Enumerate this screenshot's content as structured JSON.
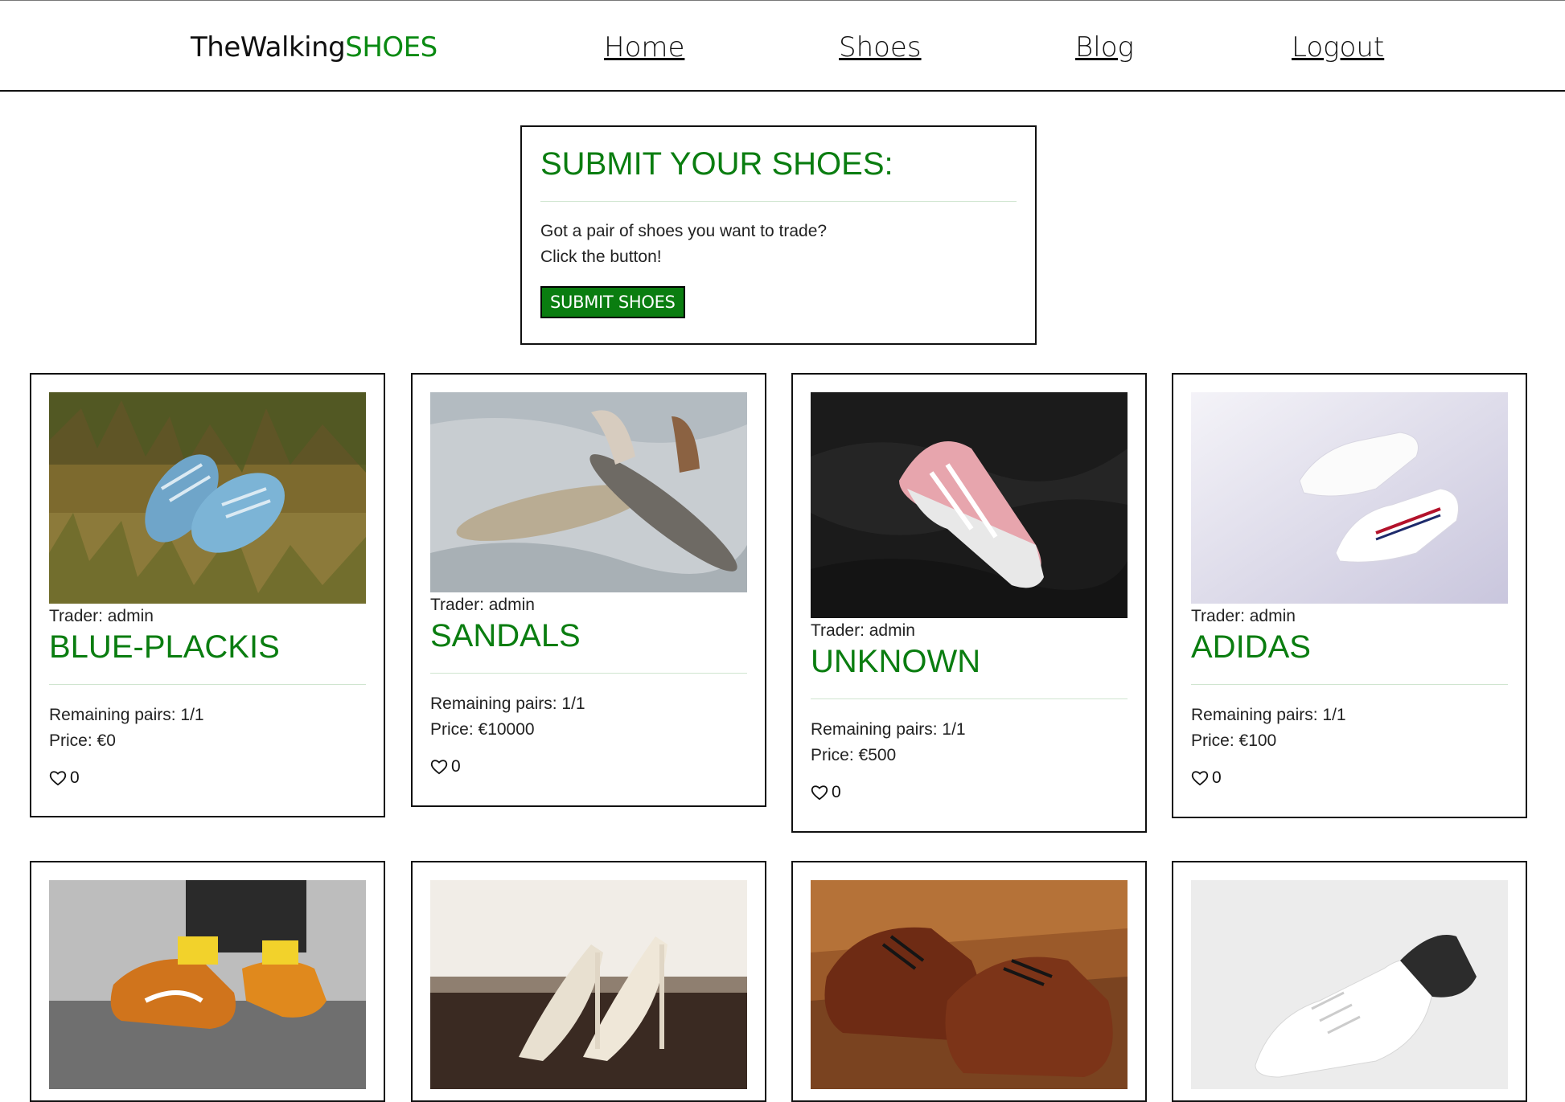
{
  "header": {
    "brand_prefix": "TheWalking",
    "brand_accent": "SHOES",
    "nav": [
      {
        "label": "Home"
      },
      {
        "label": "Shoes"
      },
      {
        "label": "Blog"
      },
      {
        "label": "Logout"
      }
    ]
  },
  "submit": {
    "title": "SUBMIT YOUR SHOES:",
    "line1": "Got a pair of shoes you want to trade?",
    "line2": "Click the button!",
    "button_label": "SUBMIT SHOES"
  },
  "cards": [
    {
      "trader": "Trader: admin",
      "title": "BLUE-PLACKIS",
      "remaining": "Remaining pairs: 1/1",
      "price": "Price: €0",
      "likes": "0"
    },
    {
      "trader": "Trader: admin",
      "title": "SANDALS",
      "remaining": "Remaining pairs: 1/1",
      "price": "Price: €10000",
      "likes": "0"
    },
    {
      "trader": "Trader: admin",
      "title": "UNKNOWN",
      "remaining": "Remaining pairs: 1/1",
      "price": "Price: €500",
      "likes": "0"
    },
    {
      "trader": "Trader: admin",
      "title": "ADIDAS",
      "remaining": "Remaining pairs: 1/1",
      "price": "Price: €100",
      "likes": "0"
    }
  ],
  "colors": {
    "accent": "#0a7d10",
    "border": "#111111"
  }
}
